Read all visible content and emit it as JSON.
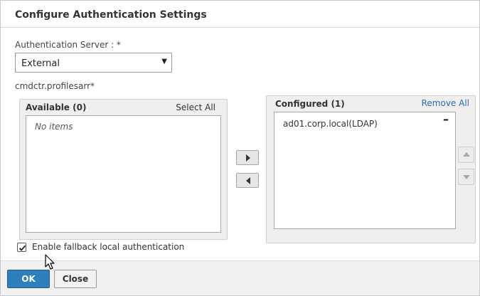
{
  "dialog": {
    "title": "Configure Authentication Settings"
  },
  "auth_server": {
    "label": "Authentication Server : *",
    "selected": "External"
  },
  "profile_name": "cmdctr.profilesarr*",
  "available": {
    "title": "Available (0)",
    "action": "Select All",
    "empty_text": "No items"
  },
  "configured": {
    "title": "Configured (1)",
    "action": "Remove All",
    "items": [
      {
        "label": "ad01.corp.local(LDAP)",
        "remove": "–"
      }
    ]
  },
  "fallback": {
    "label": "Enable fallback local authentication",
    "checked": true
  },
  "footer": {
    "ok_label": "OK",
    "close_label": "Close"
  },
  "colors": {
    "primary_button": "#2f7ebc",
    "panel_bg": "#efefef",
    "footer_bg": "#f1f1f1"
  },
  "icons": [
    "arrow-right-icon",
    "arrow-left-icon",
    "arrow-up-icon",
    "arrow-down-icon",
    "remove-icon",
    "checkmark-icon",
    "dropdown-arrow-icon",
    "mouse-cursor-icon"
  ]
}
